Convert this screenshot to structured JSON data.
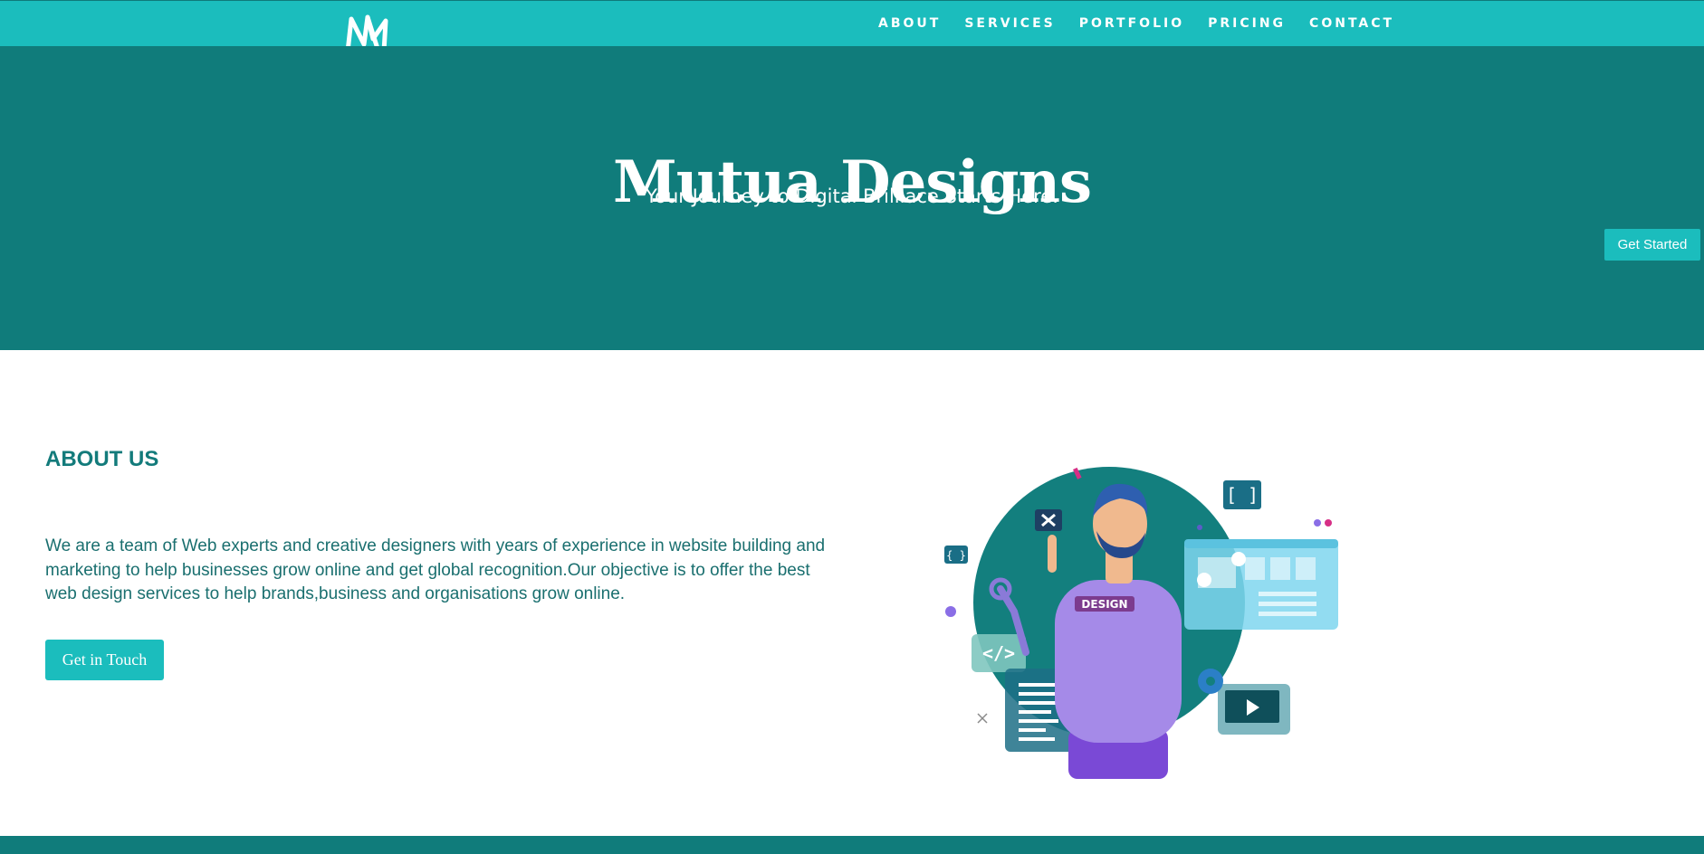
{
  "colors": {
    "nav_bg": "#1bbdbd",
    "hero_bg": "#107c7b",
    "accent": "#1bbdbd",
    "heading": "#137b7b",
    "body_text": "#1a6f6f"
  },
  "logo": {
    "icon": "m-monogram-logo-icon"
  },
  "nav": {
    "items": [
      {
        "label": "ABOUT"
      },
      {
        "label": "SERVICES"
      },
      {
        "label": "PORTFOLIO"
      },
      {
        "label": "PRICING"
      },
      {
        "label": "CONTACT"
      }
    ]
  },
  "hero": {
    "title": "Mutua Designs",
    "subtitle": "Your Journey to Digital Brilliace Starts Here.",
    "cta_label": "Get Started"
  },
  "about": {
    "heading": "ABOUT US",
    "text": "We are a team of Web experts and creative designers with years of experience in website building and marketing to help businesses grow online and get global recognition.Our objective is to offer the best web design services to help brands,business and organisations grow online.",
    "cta_label": "Get in Touch",
    "illustration": {
      "icon": "web-designer-illustration-icon",
      "badge_text": "DESIGN"
    }
  }
}
